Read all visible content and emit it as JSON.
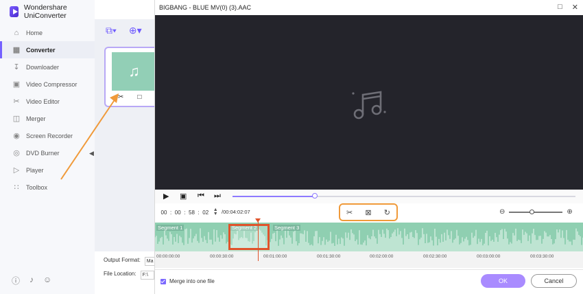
{
  "app": {
    "name": "Wondershare UniConverter"
  },
  "sidebar": {
    "items": [
      {
        "label": "Home",
        "icon": "home-icon",
        "active": false
      },
      {
        "label": "Converter",
        "icon": "converter-icon",
        "active": true
      },
      {
        "label": "Downloader",
        "icon": "download-icon",
        "active": false
      },
      {
        "label": "Video Compressor",
        "icon": "compress-icon",
        "active": false
      },
      {
        "label": "Video Editor",
        "icon": "scissors-icon",
        "active": false
      },
      {
        "label": "Merger",
        "icon": "merge-icon",
        "active": false
      },
      {
        "label": "Screen Recorder",
        "icon": "record-icon",
        "active": false
      },
      {
        "label": "DVD Burner",
        "icon": "disc-icon",
        "active": false
      },
      {
        "label": "Player",
        "icon": "play-icon",
        "active": false
      },
      {
        "label": "Toolbox",
        "icon": "grid-icon",
        "active": false
      }
    ]
  },
  "converter": {
    "output_format_label": "Output Format:",
    "output_format_value": "Ma",
    "file_location_label": "File Location:",
    "file_location_value": "F:\\"
  },
  "dialog": {
    "title": "BIGBANG - BLUE MV(0) (3).AAC",
    "progress_fraction": 0.24,
    "time": {
      "hh": "00",
      "mm": "00",
      "ss": "58",
      "ff": "02"
    },
    "total_time": "/00:04:02:07",
    "zoom_fraction": 0.42,
    "segments": [
      {
        "label": "Segment 1"
      },
      {
        "label": "Segment 2"
      },
      {
        "label": "Segment 3"
      }
    ],
    "ticks": [
      "00:00:00:00",
      "00:00:30:00",
      "00:01:00:00",
      "00:01:30:00",
      "00:02:00:00",
      "00:02:30:00",
      "00:03:00:00",
      "00:03:30:00"
    ],
    "merge_label": "Merge into one file",
    "ok_label": "OK",
    "cancel_label": "Cancel"
  },
  "colors": {
    "accent": "#7460ff",
    "waveform": "#8fcfb1",
    "highlight": "#e0532b",
    "annotation": "#f09a3a",
    "preview_bg": "#24242b"
  }
}
